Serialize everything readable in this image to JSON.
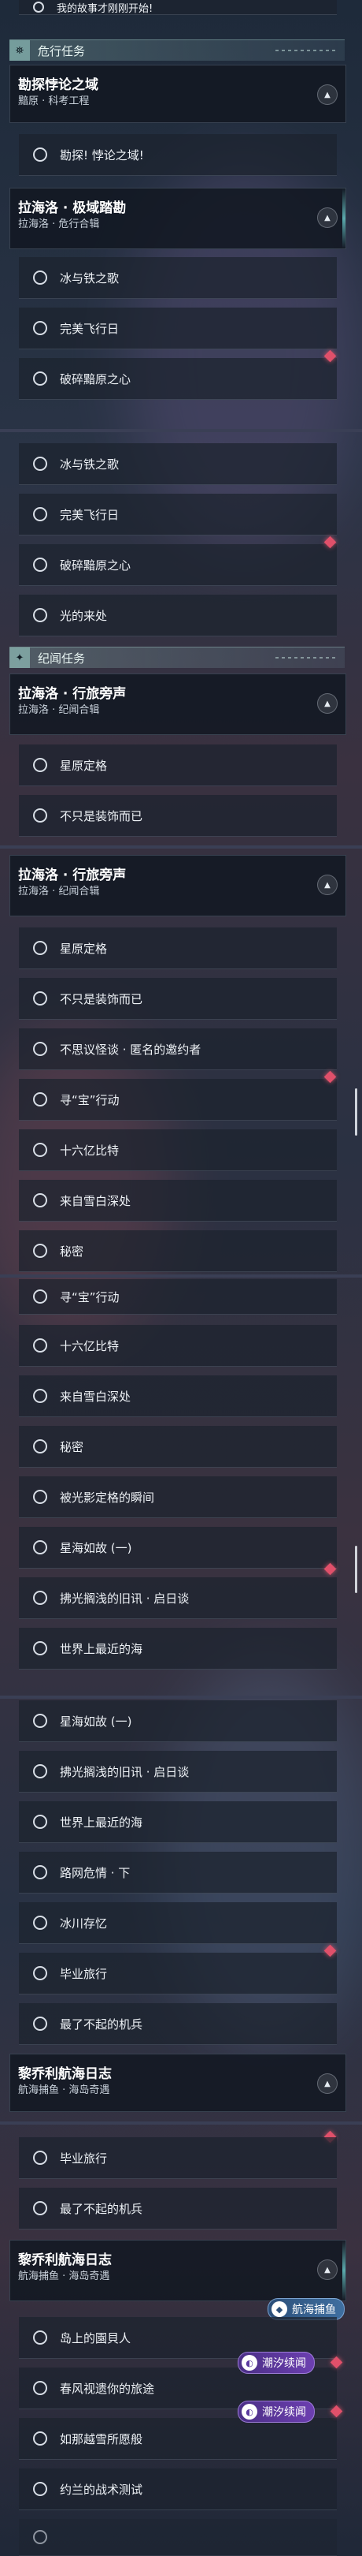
{
  "top": {
    "partial_item": "我的故事才刚刚开始!"
  },
  "sections": {
    "danger": "危行任务",
    "chronicle": "纪闻任务"
  },
  "cards": {
    "kantan": {
      "title": "勘探悖论之域",
      "subtitle": "黯原 · 科考工程"
    },
    "lahailuo_jiyu": {
      "title": "拉海洛 · 极域踏勘",
      "subtitle": "拉海洛 · 危行合辑"
    },
    "lahailuo_xinglv": {
      "title": "拉海洛 · 行旅旁声",
      "subtitle": "拉海洛 · 纪闻合辑"
    },
    "liqiaoli": {
      "title": "黎乔利航海日志",
      "subtitle": "航海捕鱼 · 海岛奇遇"
    }
  },
  "items": {
    "wuhu": "勘探! 悖论之域!",
    "bingyutie": "冰与铁之歌",
    "wanmei": "完美飞行日",
    "posui": "破碎黯原之心",
    "guangde": "光的来处",
    "xingyuan": "星原定格",
    "buzhi": "不只是装饰而已",
    "bukesi": "不思议怪谈 · 匿名的邀约者",
    "xunbao": "寻“宝”行动",
    "shiliuyi": "十六亿比特",
    "laizi": "来自雪白深处",
    "mimi": "秘密",
    "beiguang": "被光影定格的瞬间",
    "xinghai": "星海如故 (一)",
    "fuguang": "拂光搁浅的旧讯 · 启日谈",
    "shijie": "世界上最近的海",
    "luwang": "路网危情 · 下",
    "bingchuan": "冰川存忆",
    "biye": "毕业旅行",
    "liaobuqi": "最了不起的机兵",
    "daoshang": "岛上的園貝人",
    "chunfeng": "春风视遗你的旅途",
    "rujiang": "如那越雪所愿般",
    "yuelan": "约兰的战术测试"
  },
  "tags": {
    "chaoxi": "潮汐续闻",
    "hanghai": "航海捕鱼"
  },
  "colors": {
    "accent": "#a0d7cd",
    "alert": "#e0506a",
    "tag": "#6c3fb0"
  }
}
